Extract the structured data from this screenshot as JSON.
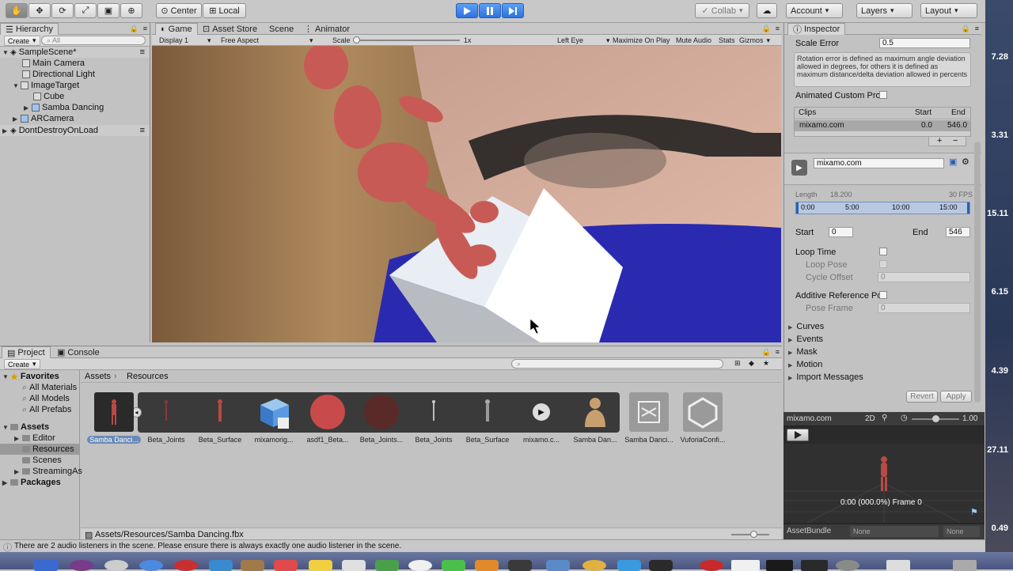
{
  "toolbar": {
    "tools": [
      "hand-tool-icon",
      "move-tool-icon",
      "rotate-tool-icon",
      "scale-tool-icon",
      "rect-tool-icon",
      "transform-tool-icon"
    ],
    "center_label": "Center",
    "local_label": "Local",
    "collab_label": "Collab",
    "account_label": "Account",
    "layers_label": "Layers",
    "layout_label": "Layout"
  },
  "hierarchy": {
    "tab_label": "Hierarchy",
    "create_label": "Create",
    "search_placeholder": "All",
    "items": [
      {
        "label": "SampleScene*"
      },
      {
        "label": "Main Camera"
      },
      {
        "label": "Directional Light"
      },
      {
        "label": "ImageTarget"
      },
      {
        "label": "Cube"
      },
      {
        "label": "Samba Dancing"
      },
      {
        "label": "ARCamera"
      },
      {
        "label": "DontDestroyOnLoad"
      }
    ]
  },
  "game": {
    "tabs": [
      {
        "label": "Game"
      },
      {
        "label": "Asset Store"
      },
      {
        "label": "Scene"
      },
      {
        "label": "Animator"
      }
    ],
    "display": "Display 1",
    "aspect": "Free Aspect",
    "scale_label": "Scale",
    "scale_value": "1x",
    "eye": "Left Eye",
    "maximize": "Maximize On Play",
    "mute": "Mute Audio",
    "stats": "Stats",
    "gizmos": "Gizmos"
  },
  "inspector": {
    "tab_label": "Inspector",
    "scale_error_label": "Scale Error",
    "scale_error_value": "0.5",
    "help_text": "Rotation error is defined as maximum angle deviation allowed in degrees, for others it is defined as maximum distance/delta deviation allowed in percents",
    "animated_custom_label": "Animated Custom Pro",
    "clips_header": {
      "clips": "Clips",
      "start": "Start",
      "end": "End"
    },
    "clip": {
      "name": "mixamo.com",
      "start": "0.0",
      "end": "546.0"
    },
    "plus": "+",
    "minus": "−",
    "clip_name_value": "mixamo.com",
    "length_label": "Length",
    "length_value": "18.200",
    "fps": "30 FPS",
    "timeline_ticks": [
      "0:00",
      "5:00",
      "10:00",
      "15:00"
    ],
    "start_label": "Start",
    "start_value": "0",
    "end_label": "End",
    "end_value": "546",
    "loop_time": "Loop Time",
    "loop_pose": "Loop Pose",
    "cycle_offset": "Cycle Offset",
    "cycle_offset_value": "0",
    "additive": "Additive Reference Po",
    "pose_frame": "Pose Frame",
    "pose_frame_value": "0",
    "folds": [
      "Curves",
      "Events",
      "Mask",
      "Motion",
      "Import Messages"
    ],
    "revert": "Revert",
    "apply": "Apply"
  },
  "preview": {
    "name": "mixamo.com",
    "mode_2d": "2D",
    "speed": "1.00",
    "time_text": "0:00 (000.0%) Frame 0",
    "assetbundle_label": "AssetBundle",
    "assetbundle_value": "None",
    "variant_value": "None"
  },
  "project": {
    "tabs": [
      {
        "label": "Project"
      },
      {
        "label": "Console"
      }
    ],
    "create_label": "Create",
    "favorites": "Favorites",
    "fav_items": [
      "All Materials",
      "All Models",
      "All Prefabs"
    ],
    "assets": "Assets",
    "asset_folders": [
      "Editor",
      "Resources",
      "Scenes",
      "StreamingAs"
    ],
    "packages": "Packages",
    "breadcrumb": {
      "root": "Assets",
      "current": "Resources"
    },
    "items": [
      {
        "name": "Samba Danci..."
      },
      {
        "name": "Beta_Joints"
      },
      {
        "name": "Beta_Surface"
      },
      {
        "name": "mixamorig..."
      },
      {
        "name": "asdf1_Beta..."
      },
      {
        "name": "Beta_Joints..."
      },
      {
        "name": "Beta_Joints"
      },
      {
        "name": "Beta_Surface"
      },
      {
        "name": "mixamo.c..."
      },
      {
        "name": "Samba Dan..."
      },
      {
        "name": "Samba Danci..."
      },
      {
        "name": "VuforiaConfi..."
      }
    ],
    "path": "Assets/Resources/Samba Dancing.fbx"
  },
  "status": {
    "message": "There are 2 audio listeners in the scene. Please ensure there is always exactly one audio listener in the scene."
  },
  "right_strip": [
    "7.28",
    "3.31",
    "15.11",
    "6.15",
    "4.39",
    "27.11",
    "0.49"
  ]
}
